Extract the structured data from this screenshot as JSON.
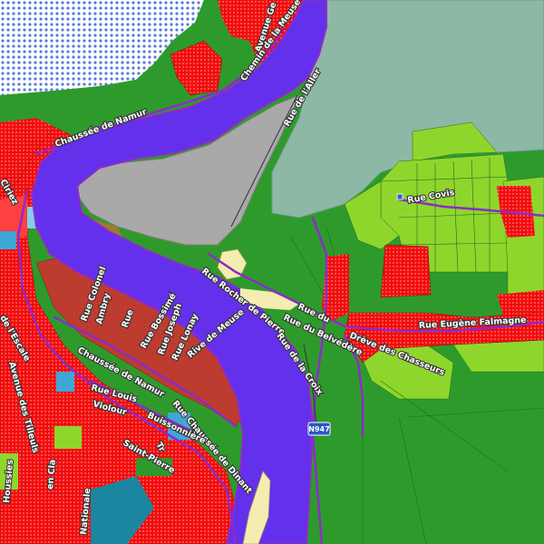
{
  "map": {
    "colors": {
      "river": "#6a2cf0",
      "residential": "#f20d0d",
      "agricultural_dark": "#2f9a2c",
      "agricultural_light": "#8fd62c",
      "water_gray": "#8db8a6",
      "sand": "#a9a9a9",
      "road": "#8c2cc8"
    },
    "streets": [
      "Chaussée de Namur",
      "Avenue Ge",
      "Chemin de la Meuse",
      "Rue de l'Aller",
      "Rue Covis",
      "Rue du Belvédère",
      "Rue Rocher de Pierre",
      "Rue Eugène Falmagne",
      "Drève des Chasseurs",
      "Rue de la Croix",
      "Rive de Meuse",
      "Rue Lonay",
      "Rue Bossimé",
      "Chaussée de Namur",
      "Rue Chaussée de Dinant",
      "Rue Louis",
      "Violour",
      "Buissonnière",
      "Saint-Pierre",
      "Avenue des Tilleuls",
      "de l'Escale",
      "Rue Colonel",
      "Rue du",
      "Ambry",
      "Rue",
      "Rue Joseph",
      "Tr",
      "Ciriez",
      "Nationale",
      "Houssies",
      "en Cla"
    ],
    "route_shield": "N947"
  }
}
